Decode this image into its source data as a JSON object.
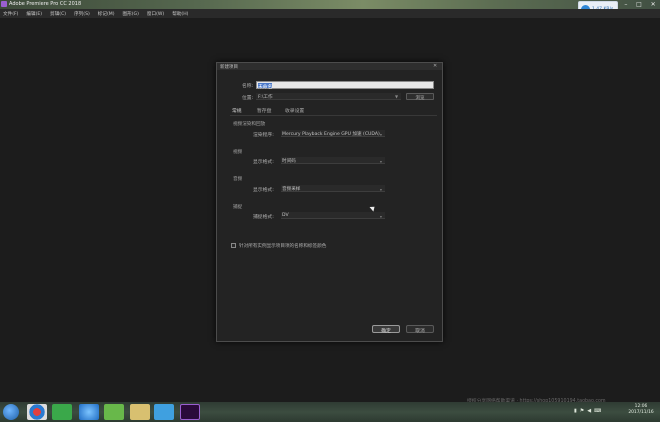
{
  "window": {
    "title": "Adobe Premiere Pro CC 2018",
    "controls": {
      "minimize": "–",
      "maximize": "□",
      "close": "✕"
    }
  },
  "net_widget": {
    "speed": "1.47 KB/s"
  },
  "menubar": {
    "items": [
      "文件(F)",
      "编辑(E)",
      "剪辑(C)",
      "序列(S)",
      "标记(M)",
      "图形(G)",
      "窗口(W)",
      "帮助(H)"
    ]
  },
  "dialog": {
    "title": "新建项目",
    "close_glyph": "✕",
    "name_label": "名称:",
    "name_value": "未命名",
    "location_label": "位置:",
    "location_value": "F:\\工作",
    "browse_label": "浏览",
    "tabs": [
      {
        "label": "常规",
        "active": true
      },
      {
        "label": "暂存盘",
        "active": false
      },
      {
        "label": "收录设置",
        "active": false
      }
    ],
    "renderer_section": "视频渲染和回放",
    "renderer_label": "渲染程序:",
    "renderer_value": "Mercury Playback Engine GPU 加速 (CUDA)",
    "video_section": "视频",
    "video_display_label": "显示格式:",
    "video_display_value": "时间码",
    "audio_section": "音频",
    "audio_display_label": "显示格式:",
    "audio_display_value": "音频采样",
    "capture_section": "捕捉",
    "capture_format_label": "捕捉格式:",
    "capture_format_value": "DV",
    "checkbox_label": "针对所有实例显示项目项的名称和标签颜色",
    "ok_label": "确定",
    "cancel_label": "取消"
  },
  "watermark": "授权分享网络帮助渠道 · https://shop105910194.taobao.com",
  "clock": {
    "time": "12:06",
    "date": "2017/11/16"
  },
  "colors": {
    "workspace": "#1c1c1c",
    "dialog_bg": "#232323",
    "selection": "#4a78c8",
    "premiere_purple": "#9a5fd0"
  }
}
